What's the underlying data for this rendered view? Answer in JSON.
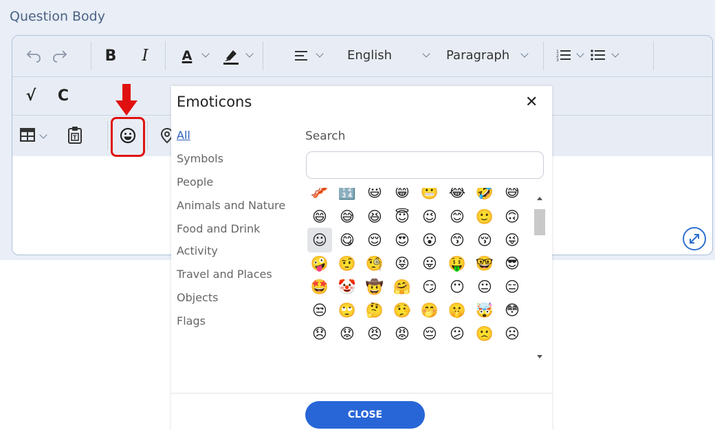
{
  "question_label": "Question Body",
  "toolbar": {
    "bold": "B",
    "italic": "I",
    "font_color_letter": "A",
    "language": "English",
    "block_format": "Paragraph",
    "formula_glyph": "√",
    "chem_glyph": "C"
  },
  "dialog": {
    "title": "Emoticons",
    "close_icon": "✕",
    "search_label": "Search",
    "search_value": "",
    "categories": [
      "All",
      "Symbols",
      "People",
      "Animals and Nature",
      "Food and Drink",
      "Activity",
      "Travel and Places",
      "Objects",
      "Flags"
    ],
    "active_category": "All",
    "close_button": "CLOSE"
  },
  "emoji_rows": [
    [
      "🥓",
      "🔢",
      "😃",
      "😁",
      "😬",
      "😂",
      "🤣",
      "😅"
    ],
    [
      "😄",
      "😅",
      "😆",
      "😇",
      "😉",
      "😊",
      "🙂",
      "🙃"
    ],
    [
      "☺",
      "😋",
      "😌",
      "😍",
      "😮",
      "😙",
      "😚",
      "😜"
    ],
    [
      "🤪",
      "🤨",
      "🧐",
      "😝",
      "😛",
      "🤑",
      "🤓",
      "😎"
    ],
    [
      "🤩",
      "🤡",
      "🤠",
      "🤗",
      "😏",
      "😶",
      "😐",
      "😑"
    ],
    [
      "😒",
      "🙄",
      "🤔",
      "🤥",
      "🤭",
      "🤫",
      "🤯",
      "😳"
    ],
    [
      "😞",
      "😟",
      "😠",
      "😡",
      "😔",
      "😕",
      "🙁",
      "☹"
    ]
  ],
  "colors": {
    "accent": "#2866d8",
    "highlight": "#e01010",
    "toolbar_bg": "#e8edf5"
  }
}
